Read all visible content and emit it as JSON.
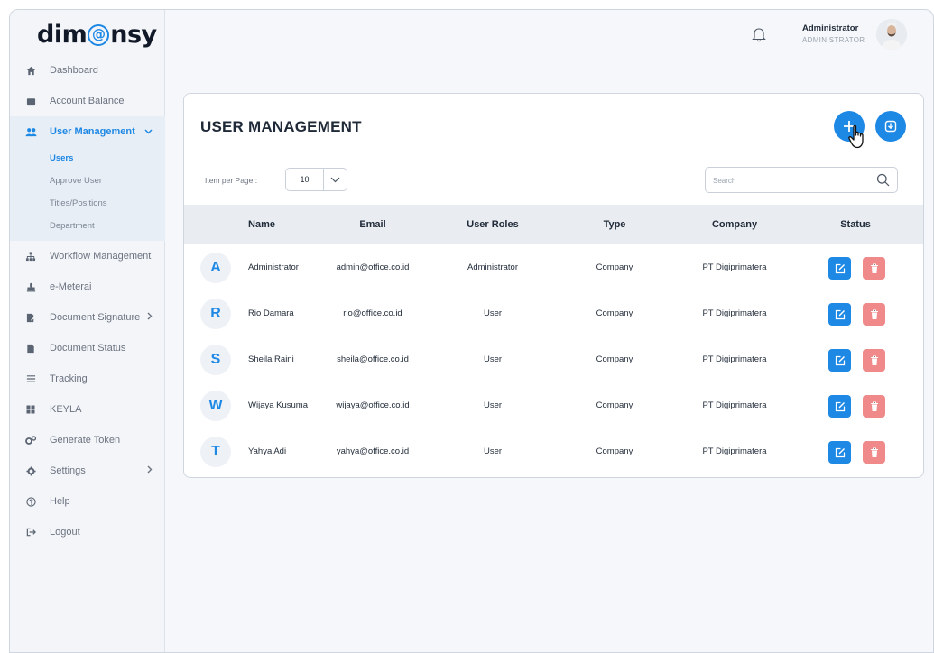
{
  "brand": {
    "logo_prefix": "dim",
    "logo_o": "@",
    "logo_suffix": "nsy"
  },
  "sidebar": {
    "items": [
      {
        "label": "Dashboard",
        "icon": "home-icon"
      },
      {
        "label": "Account Balance",
        "icon": "wallet-icon"
      },
      {
        "label": "User Management",
        "icon": "users-icon",
        "active": true,
        "expanded": true,
        "children": [
          "Users",
          "Approve User",
          "Titles/Positions",
          "Department"
        ],
        "selected_child": "Users"
      },
      {
        "label": "Workflow Management",
        "icon": "workflow-icon"
      },
      {
        "label": "e-Meterai",
        "icon": "stamp-icon"
      },
      {
        "label": "Document Signature",
        "icon": "signature-icon",
        "has_submenu": true
      },
      {
        "label": "Document Status",
        "icon": "document-icon"
      },
      {
        "label": "Tracking",
        "icon": "list-icon"
      },
      {
        "label": "KEYLA",
        "icon": "grid-icon"
      },
      {
        "label": "Generate Token",
        "icon": "gears-icon"
      },
      {
        "label": "Settings",
        "icon": "gear-icon",
        "has_submenu": true
      },
      {
        "label": "Help",
        "icon": "help-icon"
      },
      {
        "label": "Logout",
        "icon": "logout-icon"
      }
    ]
  },
  "header": {
    "user_name": "Administrator",
    "user_role": "ADMINISTRATOR"
  },
  "page": {
    "title": "USER MANAGEMENT",
    "items_per_page_label": "Item per Page :",
    "items_per_page_value": "10",
    "search_placeholder": "Search"
  },
  "table": {
    "columns": [
      "Name",
      "Email",
      "User Roles",
      "Type",
      "Company",
      "Status"
    ],
    "rows": [
      {
        "initial": "A",
        "name": "Administrator",
        "email": "admin@office.co.id",
        "role": "Administrator",
        "type": "Company",
        "company": "PT Digiprimatera"
      },
      {
        "initial": "R",
        "name": "Rio Damara",
        "email": "rio@office.co.id",
        "role": "User",
        "type": "Company",
        "company": "PT Digiprimatera"
      },
      {
        "initial": "S",
        "name": "Sheila Raini",
        "email": "sheila@office.co.id",
        "role": "User",
        "type": "Company",
        "company": "PT Digiprimatera"
      },
      {
        "initial": "W",
        "name": "Wijaya Kusuma",
        "email": "wijaya@office.co.id",
        "role": "User",
        "type": "Company",
        "company": "PT Digiprimatera"
      },
      {
        "initial": "T",
        "name": "Yahya Adi",
        "email": "yahya@office.co.id",
        "role": "User",
        "type": "Company",
        "company": "PT Digiprimatera"
      }
    ]
  },
  "colors": {
    "accent": "#1e88e5",
    "danger": "#f08a8a",
    "header_bg": "#e9edf2"
  }
}
